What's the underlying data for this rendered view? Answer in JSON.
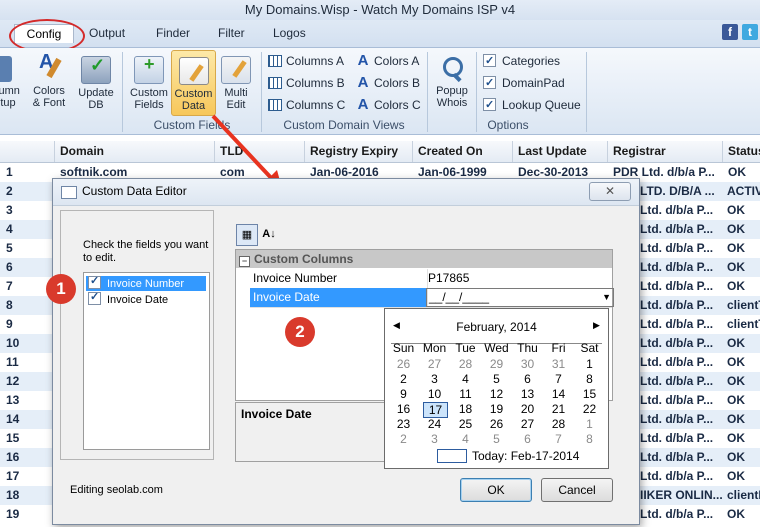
{
  "window": {
    "title": "My Domains.Wisp - Watch My Domains ISP v4"
  },
  "tabs": [
    "Config",
    "Output",
    "Finder",
    "Filter",
    "Logos"
  ],
  "ribbon": {
    "left_partial": {
      "line1": "lumn",
      "line2": "tup"
    },
    "colors_font": {
      "line1": "Colors",
      "line2": "& Font"
    },
    "update_db": {
      "line1": "Update",
      "line2": "DB"
    },
    "custom_fields": {
      "line1": "Custom",
      "line2": "Fields"
    },
    "custom_data": {
      "line1": "Custom",
      "line2": "Data"
    },
    "multi_edit": {
      "line1": "Multi",
      "line2": "Edit"
    },
    "custom_fields_group": "Custom Fields",
    "columns": [
      "Columns A",
      "Columns B",
      "Columns C"
    ],
    "colors": [
      "Colors A",
      "Colors B",
      "Colors C"
    ],
    "views_group": "Custom Domain Views",
    "popup_whois": {
      "line1": "Popup",
      "line2": "Whois"
    },
    "options": [
      "Categories",
      "DomainPad",
      "Lookup Queue"
    ],
    "options_group": "Options"
  },
  "table": {
    "headers": [
      "Domain",
      "TLD",
      "Registry Expiry",
      "Created On",
      "Last Update",
      "Registrar",
      "Status"
    ],
    "row_numbers": [
      "1",
      "2",
      "3",
      "4",
      "5",
      "6",
      "7",
      "8",
      "9",
      "10",
      "11",
      "12",
      "13",
      "14",
      "15",
      "16",
      "17",
      "18",
      "19"
    ],
    "row1": {
      "domain": "softnik.com",
      "tld": "com",
      "expiry": "Jan-06-2016",
      "created": "Jan-06-1999",
      "updated": "Dec-30-2013",
      "registrar": "PDR Ltd. d/b/a P...",
      "status": "OK"
    },
    "registrar_col": [
      "",
      "LTD. D/B/A ...",
      "Ltd. d/b/a P...",
      "Ltd. d/b/a P...",
      "Ltd. d/b/a P...",
      "Ltd. d/b/a P...",
      "Ltd. d/b/a P...",
      "Ltd. d/b/a P...",
      "Ltd. d/b/a P...",
      "Ltd. d/b/a P...",
      "Ltd. d/b/a P...",
      "Ltd. d/b/a P...",
      "Ltd. d/b/a P...",
      "Ltd. d/b/a P...",
      "Ltd. d/b/a P...",
      "Ltd. d/b/a P...",
      "Ltd. d/b/a P...",
      "IIKER ONLIN...",
      "Ltd. d/b/a P..."
    ],
    "status_col": [
      "",
      "ACTIV",
      "OK",
      "OK",
      "OK",
      "OK",
      "OK",
      "clientT",
      "clientT",
      "OK",
      "OK",
      "OK",
      "OK",
      "OK",
      "OK",
      "OK",
      "OK",
      "clientI",
      "OK"
    ]
  },
  "dialog": {
    "title": "Custom Data Editor",
    "close_label": "✕",
    "instructions": "Check the fields you want to edit.",
    "fields": [
      {
        "label": "Invoice Number",
        "checked": true,
        "selected": true
      },
      {
        "label": "Invoice Date",
        "checked": true,
        "selected": false
      }
    ],
    "badge1": "1",
    "badge2": "2",
    "category": "Custom Columns",
    "props": [
      {
        "name": "Invoice Number",
        "value": "P17865"
      },
      {
        "name": "Invoice Date",
        "value": "__/__/____"
      }
    ],
    "description_title": "Invoice Date",
    "footer": "Editing seolab.com",
    "ok_label": "OK",
    "cancel_label": "Cancel"
  },
  "calendar": {
    "month": "February, 2014",
    "weekdays": [
      "Sun",
      "Mon",
      "Tue",
      "Wed",
      "Thu",
      "Fri",
      "Sat"
    ],
    "weeks": [
      [
        "26",
        "27",
        "28",
        "29",
        "30",
        "31",
        "1"
      ],
      [
        "2",
        "3",
        "4",
        "5",
        "6",
        "7",
        "8"
      ],
      [
        "9",
        "10",
        "11",
        "12",
        "13",
        "14",
        "15"
      ],
      [
        "16",
        "17",
        "18",
        "19",
        "20",
        "21",
        "22"
      ],
      [
        "23",
        "24",
        "25",
        "26",
        "27",
        "28",
        "1"
      ],
      [
        "2",
        "3",
        "4",
        "5",
        "6",
        "7",
        "8"
      ]
    ],
    "selected_day": "17",
    "today_label": "Today: Feb-17-2014"
  },
  "colors": {
    "accent": "#d93a2c",
    "selection": "#3399ff",
    "header_bg": "#dde8f5"
  }
}
